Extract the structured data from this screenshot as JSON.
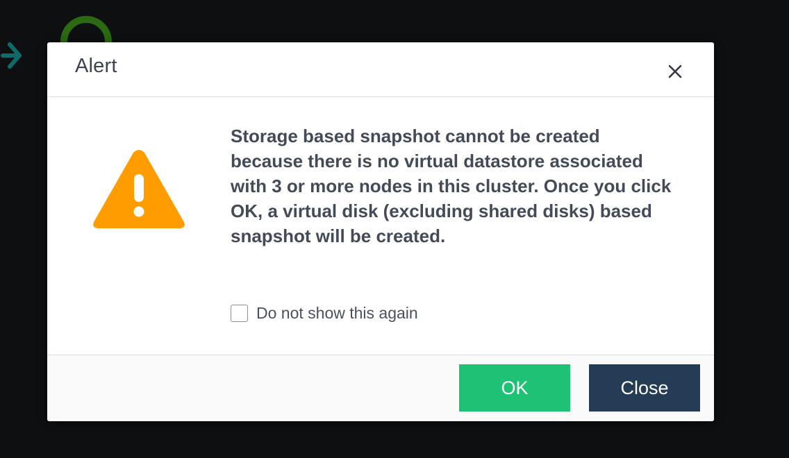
{
  "dialog": {
    "title": "Alert",
    "message": "Storage based snapshot cannot be created because there is no virtual datastore associated with 3 or more nodes in this cluster. Once you click OK, a virtual disk (excluding shared disks) based snapshot will be created.",
    "checkbox": {
      "label": "Do not show this again",
      "checked": false
    },
    "buttons": {
      "ok_label": "OK",
      "close_label": "Close"
    },
    "icons": {
      "warning": "warning-triangle-icon",
      "close": "close-icon"
    }
  },
  "colors": {
    "ok_button": "#1fc274",
    "close_button": "#243c55",
    "warning_icon": "#ff9d00",
    "backdrop": "#0e0f11"
  }
}
